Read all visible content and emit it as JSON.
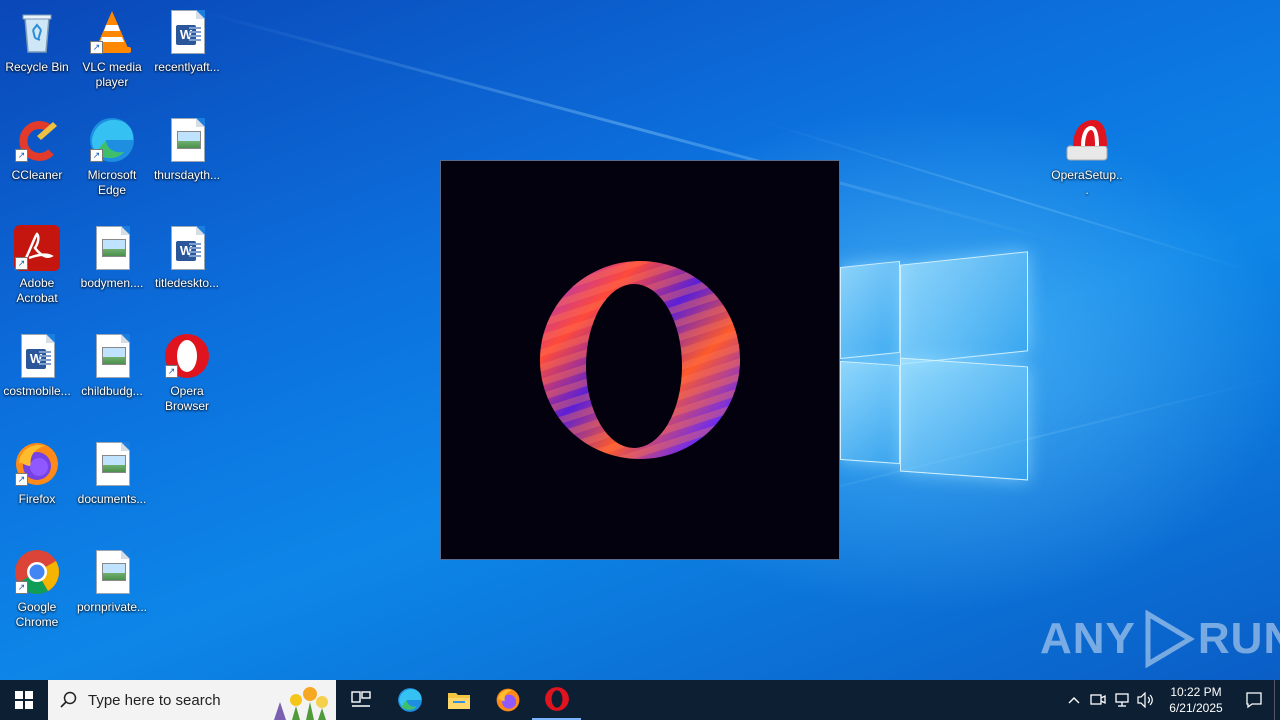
{
  "desktop": {
    "icons": [
      {
        "label": "Recycle Bin",
        "icon": "recycle-bin-icon"
      },
      {
        "label": "VLC media player",
        "icon": "vlc-icon"
      },
      {
        "label": "recentlyaft...",
        "icon": "word-document-icon"
      },
      {
        "label": "CCleaner",
        "icon": "ccleaner-icon"
      },
      {
        "label": "Microsoft Edge",
        "icon": "edge-icon"
      },
      {
        "label": "thursdayth...",
        "icon": "image-file-icon"
      },
      {
        "label": "Adobe Acrobat",
        "icon": "acrobat-icon"
      },
      {
        "label": "bodymen....",
        "icon": "image-file-icon"
      },
      {
        "label": "titledeskto...",
        "icon": "word-document-icon"
      },
      {
        "label": "costmobile...",
        "icon": "word-document-icon"
      },
      {
        "label": "childbudg...",
        "icon": "image-file-icon"
      },
      {
        "label": "Opera Browser",
        "icon": "opera-icon"
      },
      {
        "label": "Firefox",
        "icon": "firefox-icon"
      },
      {
        "label": "documents...",
        "icon": "image-file-icon"
      },
      {
        "label": "Google Chrome",
        "icon": "chrome-icon"
      },
      {
        "label": "pornprivate...",
        "icon": "image-file-icon"
      },
      {
        "label": "OperaSetup...",
        "icon": "opera-setup-icon"
      }
    ]
  },
  "splash": {
    "icon": "opera-logo-icon"
  },
  "watermark": {
    "text": "ANY",
    "text2": "RUN"
  },
  "taskbar": {
    "search_placeholder": "Type here to search",
    "pinned": [
      "task-view-icon",
      "edge-icon",
      "file-explorer-icon",
      "firefox-icon",
      "opera-icon"
    ],
    "clock_time": "10:22 PM",
    "clock_date": "6/21/2025"
  },
  "colors": {
    "taskbar": "#0d1f33",
    "opera_red": "#e0141e",
    "splash_bg": "#03010d"
  }
}
